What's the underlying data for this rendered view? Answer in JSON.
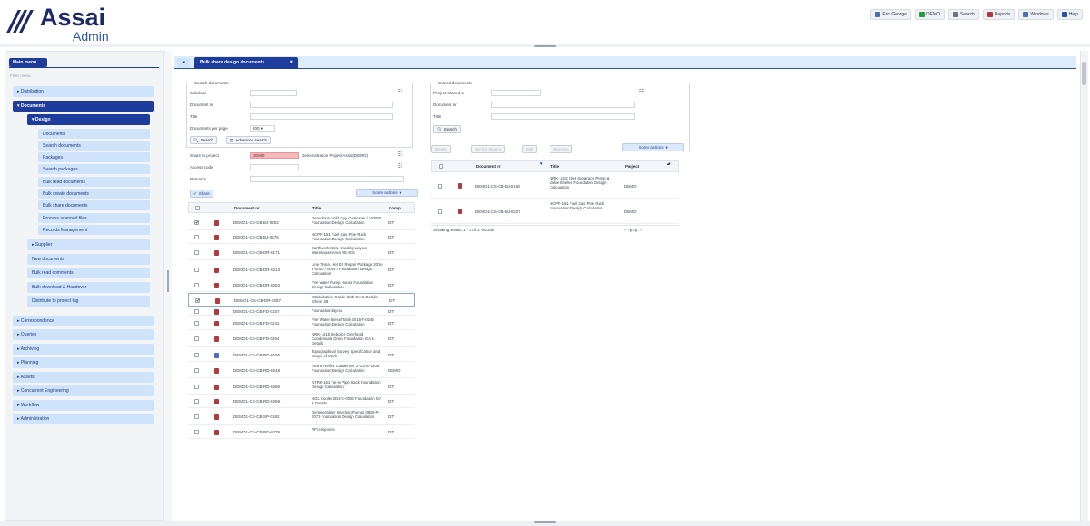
{
  "app": {
    "logo_text": "Assai",
    "logo_sub": "Admin",
    "accent": "#1d3c9c",
    "nav_bg": "#cfe3fb"
  },
  "topnav": [
    {
      "label": "Eric George",
      "icon": "user-icon"
    },
    {
      "label": "DEMO",
      "icon": "project-icon"
    },
    {
      "label": "Search",
      "icon": "search-icon"
    },
    {
      "label": "Reports",
      "icon": "report-icon"
    },
    {
      "label": "Windows",
      "icon": "windows-icon"
    },
    {
      "label": "Help",
      "icon": "help-icon"
    }
  ],
  "sidebar": {
    "tab_label": "Main menu",
    "filter_placeholder": "Filter menu",
    "items": [
      {
        "label": "Distribution",
        "level": 1,
        "state": "collapsed"
      },
      {
        "label": "Documents",
        "level": 1,
        "state": "expanded"
      },
      {
        "label": "Design",
        "level": 2,
        "state": "expanded"
      },
      {
        "label": "Documents",
        "level": 3
      },
      {
        "label": "Search documents",
        "level": 3
      },
      {
        "label": "Packages",
        "level": 3
      },
      {
        "label": "Search packages",
        "level": 3
      },
      {
        "label": "Bulk read documents",
        "level": 3
      },
      {
        "label": "Bulk create documents",
        "level": 3
      },
      {
        "label": "Bulk share documents",
        "level": 3
      },
      {
        "label": "Process scanned files",
        "level": 3
      },
      {
        "label": "Records Management",
        "level": 3
      },
      {
        "label": "Supplier",
        "level": 2,
        "state": "collapsed"
      },
      {
        "label": "New documents",
        "level": 2
      },
      {
        "label": "Bulk read comments",
        "level": 2
      },
      {
        "label": "Bulk download & Handover",
        "level": 2
      },
      {
        "label": "Distribute to project tag",
        "level": 2
      },
      {
        "label": "Correspondence",
        "level": 1,
        "state": "collapsed"
      },
      {
        "label": "Queries",
        "level": 1,
        "state": "collapsed"
      },
      {
        "label": "Archiving",
        "level": 1,
        "state": "collapsed"
      },
      {
        "label": "Planning",
        "level": 1,
        "state": "collapsed"
      },
      {
        "label": "Assets",
        "level": 1,
        "state": "collapsed"
      },
      {
        "label": "Concurrent Engineering",
        "level": 1,
        "state": "collapsed"
      },
      {
        "label": "Workflow",
        "level": 1,
        "state": "collapsed"
      },
      {
        "label": "Administration",
        "level": 1,
        "state": "collapsed"
      }
    ]
  },
  "tabs": {
    "home_icon": "home-icon",
    "active_label": "Bulk share design documents",
    "close_glyph": "✖"
  },
  "search": {
    "legend": "Search documents",
    "fields": [
      {
        "label": "Subclass",
        "value": ""
      },
      {
        "label": "Document nr",
        "value": ""
      },
      {
        "label": "Title",
        "value": ""
      }
    ],
    "per_page_label": "Documents per page",
    "per_page_value": "200",
    "search_button": "Search",
    "advanced_button": "Advanced search"
  },
  "share": {
    "fields": [
      {
        "label": "Share to project",
        "value": "DEMO",
        "extra": "Demonstration Project Assai(DEMO)"
      },
      {
        "label": "Access code",
        "value": ""
      },
      {
        "label": "Remarks",
        "value": ""
      }
    ],
    "share_button": "Share",
    "actions_button": "Some actions"
  },
  "docs_table": {
    "columns": [
      "Document nr",
      "Title",
      "Comp"
    ],
    "rows": [
      {
        "checked": true,
        "nr": "DEMO1-CS-CB-BJ-0202",
        "title": "Demolition Hold Cpy Coalescer / V-0005 Foundation Design Calculation",
        "comp": "DIT",
        "icon": "pdf"
      },
      {
        "checked": false,
        "nr": "DEMO1-CS-CB-BJ-0275",
        "title": "NCPR-151 Fuel Gas Pipe Rack Foundation Design Calculation",
        "comp": "DIT",
        "icon": "pdf"
      },
      {
        "checked": false,
        "nr": "DEMO1-CS-CB-DR-0171",
        "title": "Earthworks Site Grading Layout Warehouse Area RE-875",
        "comp": "DIT",
        "icon": "pdf"
      },
      {
        "checked": false,
        "nr": "DEMO1-CS-CB-DR-0213",
        "title": "Line Tema, Het E2 Repair Package 2016-8-0020 / 0004 / Foundation Design Calculation",
        "comp": "DIT",
        "icon": "pdf"
      },
      {
        "checked": false,
        "nr": "DEMO1-CS-CB-DR-0253",
        "title": "Fire water Pump House Foundation Design Calculation",
        "comp": "DIT",
        "icon": "pdf"
      },
      {
        "checked": true,
        "nr": "DEMO1-CS-CB-DR-0287",
        "title": "Stabilization Grade Slab GA & Details Sheet 38",
        "comp": "DIT",
        "icon": "pdf",
        "selected": true
      },
      {
        "checked": false,
        "nr": "DEMO1-CS-CB-FD-0157",
        "title": "Foundation layout",
        "comp": "DIT",
        "icon": "pdf"
      },
      {
        "checked": false,
        "nr": "DEMO1-CS-CB-FD-0241",
        "title": "Fire Water Diesel Tank 2016-T-0245 Foundation Design Calculation",
        "comp": "DIT",
        "icon": "pdf"
      },
      {
        "checked": false,
        "nr": "DEMO1-CS-CB-FD-0264",
        "title": "NRK-1415 Deboiler Overhead Condensate Drum Foundation GA & Details",
        "comp": "DIT",
        "icon": "pdf"
      },
      {
        "checked": false,
        "nr": "DEMO1-CS-CB-RD-0156",
        "title": "Topographical Survey Specification and Scope of Work",
        "comp": "DIT",
        "icon": "doc"
      },
      {
        "checked": false,
        "nr": "DEMO1-CS-CB-RD-0248",
        "title": "Amine Reflux Condenser 2-1-2-E-0205 Foundation Design Calculation",
        "comp": "DEMO",
        "icon": "pdf"
      },
      {
        "checked": false,
        "nr": "DEMO1-CS-CB-RD-0266",
        "title": "NTRK-151 Tie-in Pipe Rack Foundation Design Calculation",
        "comp": "DIT",
        "icon": "pdf"
      },
      {
        "checked": false,
        "nr": "DEMO1-CS-CB-RD-0269",
        "title": "NGL Cooler 2D2-E-0050 Foundation GA & Details",
        "comp": "DIT",
        "icon": "pdf"
      },
      {
        "checked": false,
        "nr": "DEMO1-CS-CB-SP-0182",
        "title": "Demineraliser Injection Pumps 0853-P-0071 Foundation Design Calculation",
        "comp": "DIT",
        "icon": "pdf"
      },
      {
        "checked": false,
        "nr": "DEMO1-CS-CB-RD-0279",
        "title": "RFI response",
        "comp": "DIT",
        "icon": "pdf"
      }
    ]
  },
  "shared": {
    "legend": "Shared documents",
    "fields": [
      {
        "label": "Project shared to",
        "value": ""
      },
      {
        "label": "Document nr",
        "value": ""
      },
      {
        "label": "Title",
        "value": ""
      }
    ],
    "search_button": "Search",
    "toolbar": [
      "Delete",
      "Set for sharing",
      "Mail",
      "Remove"
    ],
    "actions_button": "Some actions",
    "columns": [
      "Document nr",
      "Title",
      "Project"
    ],
    "rows": [
      {
        "nr": "DEMO1-CS-CB-BJ-0165",
        "title": "NRK-1102 Inlet Separator Pump & Valve Shelter Foundation Design Calculation",
        "project": "DEMO"
      },
      {
        "nr": "DEMO1-CS-CB-BJ-0227",
        "title": "NCPR-151 Fuel Gas Pipe Rack Foundation Design Calculation",
        "project": "DEMO"
      }
    ],
    "footer": "Showing results 1 - 2 of 2 records"
  }
}
